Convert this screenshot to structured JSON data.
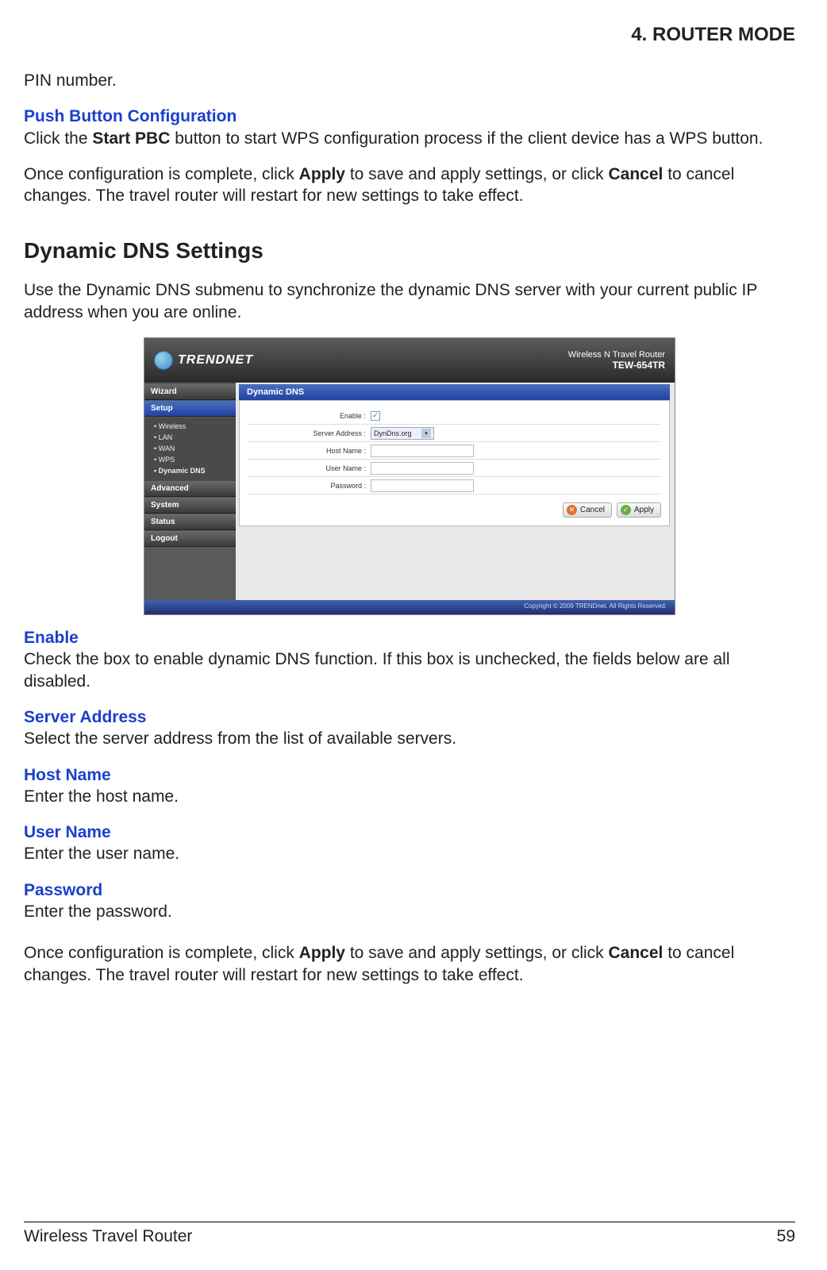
{
  "chapter": "4.  ROUTER MODE",
  "intro_continuation": "PIN number.",
  "pbc": {
    "heading": "Push Button Configuration",
    "text_pre": "Click the ",
    "text_bold1": "Start PBC",
    "text_post": " button to start WPS configuration process if the client device has a WPS button."
  },
  "apply_note1": {
    "pre": "Once configuration is complete, click ",
    "b1": "Apply",
    "mid": " to save and apply settings, or click ",
    "b2": "Cancel",
    "post": " to cancel changes. The travel router will restart for new settings to take effect."
  },
  "ddns": {
    "heading": "Dynamic DNS Settings",
    "intro": "Use the Dynamic DNS submenu to synchronize the dynamic DNS server with your current public IP address when you are online.",
    "enable": {
      "h": "Enable",
      "t": "Check the box to enable dynamic DNS function. If this box is unchecked, the fields below are all disabled."
    },
    "server": {
      "h": "Server Address",
      "t": "Select the server address from the list of available servers."
    },
    "host": {
      "h": "Host Name",
      "t": "Enter the host name."
    },
    "user": {
      "h": "User Name",
      "t": "Enter the user name."
    },
    "pass": {
      "h": "Password",
      "t": "Enter the password."
    }
  },
  "apply_note2": {
    "pre": "Once configuration is complete, click ",
    "b1": "Apply",
    "mid": " to save and apply settings, or click ",
    "b2": "Cancel",
    "post": " to cancel changes. The travel router will restart for new settings to take effect."
  },
  "screenshot": {
    "brand": "TRENDNET",
    "product_line1": "Wireless N Travel Router",
    "product_model": "TEW-654TR",
    "nav": {
      "wizard": "Wizard",
      "setup": "Setup",
      "advanced": "Advanced",
      "system": "System",
      "status": "Status",
      "logout": "Logout",
      "sub": [
        "Wireless",
        "LAN",
        "WAN",
        "WPS",
        "Dynamic DNS"
      ]
    },
    "panel_title": "Dynamic DNS",
    "fields": {
      "enable": "Enable :",
      "server": "Server Address :",
      "server_value": "DynDns.org",
      "host": "Host Name :",
      "user": "User Name :",
      "pass": "Password :"
    },
    "buttons": {
      "cancel": "Cancel",
      "apply": "Apply"
    },
    "copyright": "Copyright © 2009 TRENDnet. All Rights Reserved."
  },
  "footer": {
    "title": "Wireless Travel Router",
    "page": "59"
  }
}
